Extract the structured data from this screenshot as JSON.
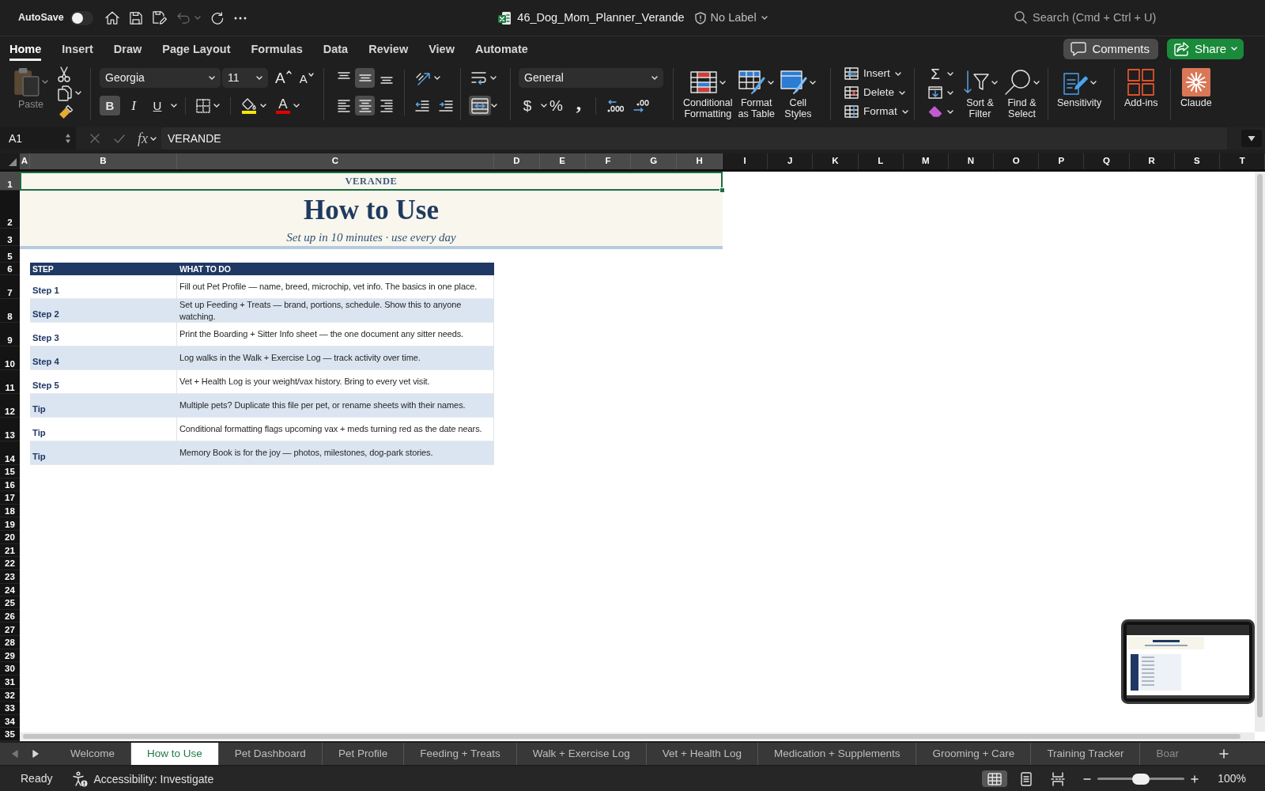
{
  "title_bar": {
    "autosave_label": "AutoSave",
    "autosave_on": false,
    "undo_disabled": true,
    "file_name": "46_Dog_Mom_Planner_Verande",
    "sensitivity_label": "No Label",
    "search": {
      "placeholder": "Search (Cmd + Ctrl + U)"
    }
  },
  "ribbon_tabs": [
    {
      "label": "Home",
      "selected": true
    },
    {
      "label": "Insert",
      "selected": false
    },
    {
      "label": "Draw",
      "selected": false
    },
    {
      "label": "Page Layout",
      "selected": false
    },
    {
      "label": "Formulas",
      "selected": false
    },
    {
      "label": "Data",
      "selected": false
    },
    {
      "label": "Review",
      "selected": false
    },
    {
      "label": "View",
      "selected": false
    },
    {
      "label": "Automate",
      "selected": false
    }
  ],
  "ribbon_actions": {
    "comments": "Comments",
    "share": "Share"
  },
  "ribbon": {
    "paste": {
      "label": "Paste",
      "disabled": true
    },
    "font_name": "Georgia",
    "font_size": "11",
    "grow_font_glyph": "A",
    "shrink_font_glyph": "A",
    "style_buttons": [
      {
        "glyph": "B",
        "pressed": true
      },
      {
        "glyph": "I",
        "pressed": false
      },
      {
        "glyph": "U",
        "pressed": false
      }
    ],
    "font_color_glyph": "A",
    "vertical_align": [
      {
        "selected": false
      },
      {
        "selected": true
      },
      {
        "selected": false
      }
    ],
    "horizontal_align": [
      {
        "selected": false
      },
      {
        "selected": true
      },
      {
        "selected": false
      }
    ],
    "merge_center_pressed": true,
    "number_format": "General",
    "number_glyphs": [
      "$",
      "%",
      ","
    ],
    "style_commands": [
      "Conditional\nFormatting",
      "Format\nas Table",
      "Cell\nStyles"
    ],
    "cell_commands": [
      "Insert",
      "Delete",
      "Format"
    ],
    "autosum_glyph": "Σ",
    "editing_commands": [
      "Sort &\nFilter",
      "Find &\nSelect"
    ],
    "sensitivity": "Sensitivity",
    "add_ins": "Add-ins",
    "claude": "Claude"
  },
  "formula_bar": {
    "name_box": "A1",
    "confirm_buttons": [
      {
        "disabled": true
      },
      {
        "disabled": true
      }
    ],
    "fx": "fx",
    "formula": "VERANDE"
  },
  "sheet": {
    "columns": [
      {
        "label": "A",
        "selected": true
      },
      {
        "label": "B",
        "selected": true
      },
      {
        "label": "C",
        "selected": true
      },
      {
        "label": "D",
        "selected": true
      },
      {
        "label": "E",
        "selected": true
      },
      {
        "label": "F",
        "selected": true
      },
      {
        "label": "G",
        "selected": true
      },
      {
        "label": "H",
        "selected": true
      },
      {
        "label": "I",
        "selected": false
      },
      {
        "label": "J",
        "selected": false
      },
      {
        "label": "K",
        "selected": false
      },
      {
        "label": "L",
        "selected": false
      },
      {
        "label": "M",
        "selected": false
      },
      {
        "label": "N",
        "selected": false
      },
      {
        "label": "O",
        "selected": false
      },
      {
        "label": "P",
        "selected": false
      },
      {
        "label": "Q",
        "selected": false
      },
      {
        "label": "R",
        "selected": false
      },
      {
        "label": "S",
        "selected": false
      },
      {
        "label": "T",
        "selected": false
      }
    ],
    "rows": [
      {
        "label": "1",
        "selected": true
      },
      {
        "label": "2",
        "selected": false
      },
      {
        "label": "3",
        "selected": false
      },
      {
        "label": "5",
        "selected": false
      },
      {
        "label": "6",
        "selected": false
      },
      {
        "label": "7",
        "selected": false
      },
      {
        "label": "8",
        "selected": false
      },
      {
        "label": "9",
        "selected": false
      },
      {
        "label": "10",
        "selected": false
      },
      {
        "label": "11",
        "selected": false
      },
      {
        "label": "12",
        "selected": false
      },
      {
        "label": "13",
        "selected": false
      },
      {
        "label": "14",
        "selected": false
      },
      {
        "label": "15",
        "selected": false
      },
      {
        "label": "16",
        "selected": false
      },
      {
        "label": "17",
        "selected": false
      },
      {
        "label": "18",
        "selected": false
      },
      {
        "label": "19",
        "selected": false
      },
      {
        "label": "20",
        "selected": false
      },
      {
        "label": "21",
        "selected": false
      },
      {
        "label": "22",
        "selected": false
      },
      {
        "label": "23",
        "selected": false
      },
      {
        "label": "24",
        "selected": false
      },
      {
        "label": "25",
        "selected": false
      },
      {
        "label": "26",
        "selected": false
      },
      {
        "label": "27",
        "selected": false
      },
      {
        "label": "28",
        "selected": false
      },
      {
        "label": "29",
        "selected": false
      },
      {
        "label": "30",
        "selected": false
      },
      {
        "label": "31",
        "selected": false
      },
      {
        "label": "32",
        "selected": false
      },
      {
        "label": "33",
        "selected": false
      },
      {
        "label": "34",
        "selected": false
      },
      {
        "label": "35",
        "selected": false
      }
    ],
    "banner": {
      "brand": "VERANDE",
      "title": "How to Use",
      "subtitle": "Set up in 10 minutes · use every day"
    },
    "table": {
      "columns": [
        "STEP",
        "WHAT TO DO"
      ],
      "rows": [
        {
          "step": "Step 1",
          "text": "Fill out Pet Profile — name, breed, microchip, vet info. The basics in one place."
        },
        {
          "step": "Step 2",
          "text": "Set up Feeding + Treats — brand, portions, schedule. Show this to anyone watching."
        },
        {
          "step": "Step 3",
          "text": "Print the Boarding + Sitter Info sheet — the one document any sitter needs."
        },
        {
          "step": "Step 4",
          "text": "Log walks in the Walk + Exercise Log — track activity over time."
        },
        {
          "step": "Step 5",
          "text": "Vet + Health Log is your weight/vax history. Bring to every vet visit."
        },
        {
          "step": "Tip",
          "text": "Multiple pets? Duplicate this file per pet, or rename sheets with their names."
        },
        {
          "step": "Tip",
          "text": "Conditional formatting flags upcoming vax + meds turning red as the date nears."
        },
        {
          "step": "Tip",
          "text": "Memory Book is for the joy — photos, milestones, dog-park stories."
        }
      ]
    }
  },
  "sheet_nav": [
    {
      "disabled": true
    },
    {
      "disabled": false
    }
  ],
  "sheet_tabs": [
    {
      "label": "Welcome",
      "selected": false
    },
    {
      "label": "How to Use",
      "selected": true
    },
    {
      "label": "Pet Dashboard",
      "selected": false
    },
    {
      "label": "Pet Profile",
      "selected": false
    },
    {
      "label": "Feeding + Treats",
      "selected": false
    },
    {
      "label": "Walk + Exercise Log",
      "selected": false
    },
    {
      "label": "Vet + Health Log",
      "selected": false
    },
    {
      "label": "Medication + Supplements",
      "selected": false
    },
    {
      "label": "Grooming + Care",
      "selected": false
    },
    {
      "label": "Training Tracker",
      "selected": false
    },
    {
      "label": "Boar",
      "selected": false
    }
  ],
  "status_bar": {
    "status": "Ready",
    "accessibility": "Accessibility: Investigate",
    "views": [
      {
        "selected": true
      },
      {
        "selected": false
      },
      {
        "selected": false
      }
    ],
    "zoom": {
      "level": 0.5,
      "reading": "100%"
    }
  }
}
